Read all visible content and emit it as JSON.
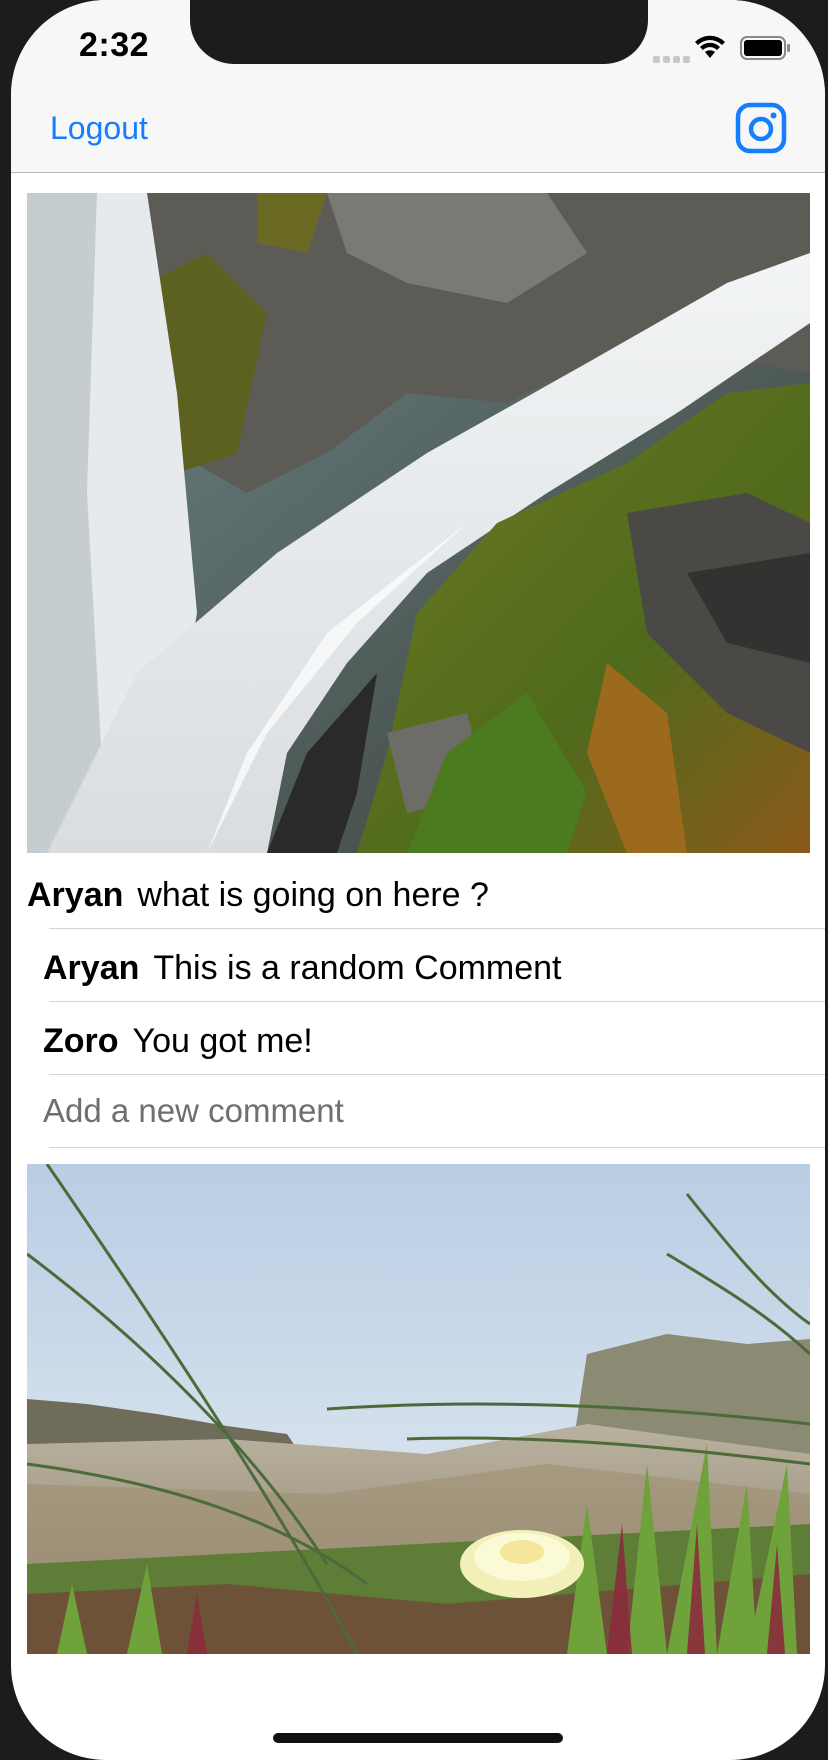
{
  "status_bar": {
    "time": "2:32"
  },
  "nav": {
    "logout_label": "Logout",
    "logo_icon": "instagram-icon"
  },
  "posts": [
    {
      "author": "Aryan",
      "caption": "what is going on here ?",
      "comments": [
        {
          "author": "Aryan",
          "text": "This is a random Comment"
        },
        {
          "author": "Zoro",
          "text": "You got me!"
        }
      ],
      "new_comment_placeholder": "Add a new comment"
    }
  ],
  "colors": {
    "accent": "#147efb",
    "separator": "#d4d4d6",
    "nav_background": "#f7f7f7"
  }
}
